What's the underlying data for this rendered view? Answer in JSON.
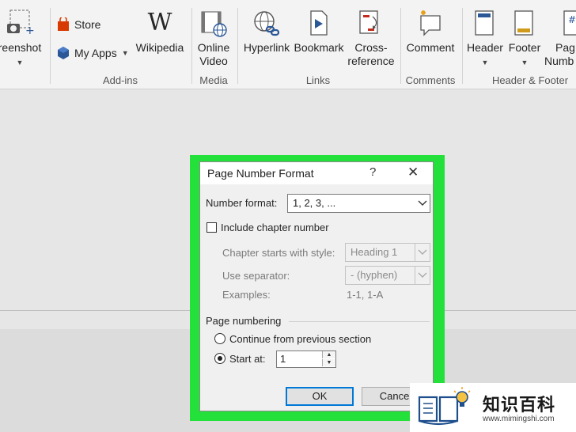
{
  "ribbon": {
    "screenshot_label": "reenshot",
    "store_label": "Store",
    "myapps_label": "My Apps",
    "wikipedia_label": "Wikipedia",
    "online_video_line1": "Online",
    "online_video_line2": "Video",
    "hyperlink_label": "Hyperlink",
    "bookmark_label": "Bookmark",
    "crossref_line1": "Cross-",
    "crossref_line2": "reference",
    "comment_label": "Comment",
    "header_label": "Header",
    "footer_label": "Footer",
    "pagenum_line1": "Pag",
    "pagenum_line2": "Numb",
    "groups": {
      "addins": "Add-ins",
      "media": "Media",
      "links": "Links",
      "comments": "Comments",
      "header_footer": "Header & Footer"
    }
  },
  "dialog": {
    "title": "Page Number Format",
    "help": "?",
    "close": "✕",
    "number_format_label": "Number format:",
    "number_format_value": "1, 2, 3, ...",
    "include_chapter_label": "Include chapter number",
    "chapter_style_label": "Chapter starts with style:",
    "chapter_style_value": "Heading 1",
    "separator_label": "Use separator:",
    "separator_value": "-   (hyphen)",
    "examples_label": "Examples:",
    "examples_value": "1-1, 1-A",
    "page_numbering_label": "Page numbering",
    "continue_label": "Continue from previous section",
    "start_at_label": "Start at:",
    "start_at_value": "1",
    "ok_label": "OK",
    "cancel_label": "Cancel"
  },
  "watermark": {
    "text": "知识百科",
    "url": "www.mimingshi.com"
  },
  "colors": {
    "highlight": "#24e03a",
    "ok_border": "#0078d7",
    "ribbon_bg": "#f3f3f3"
  }
}
